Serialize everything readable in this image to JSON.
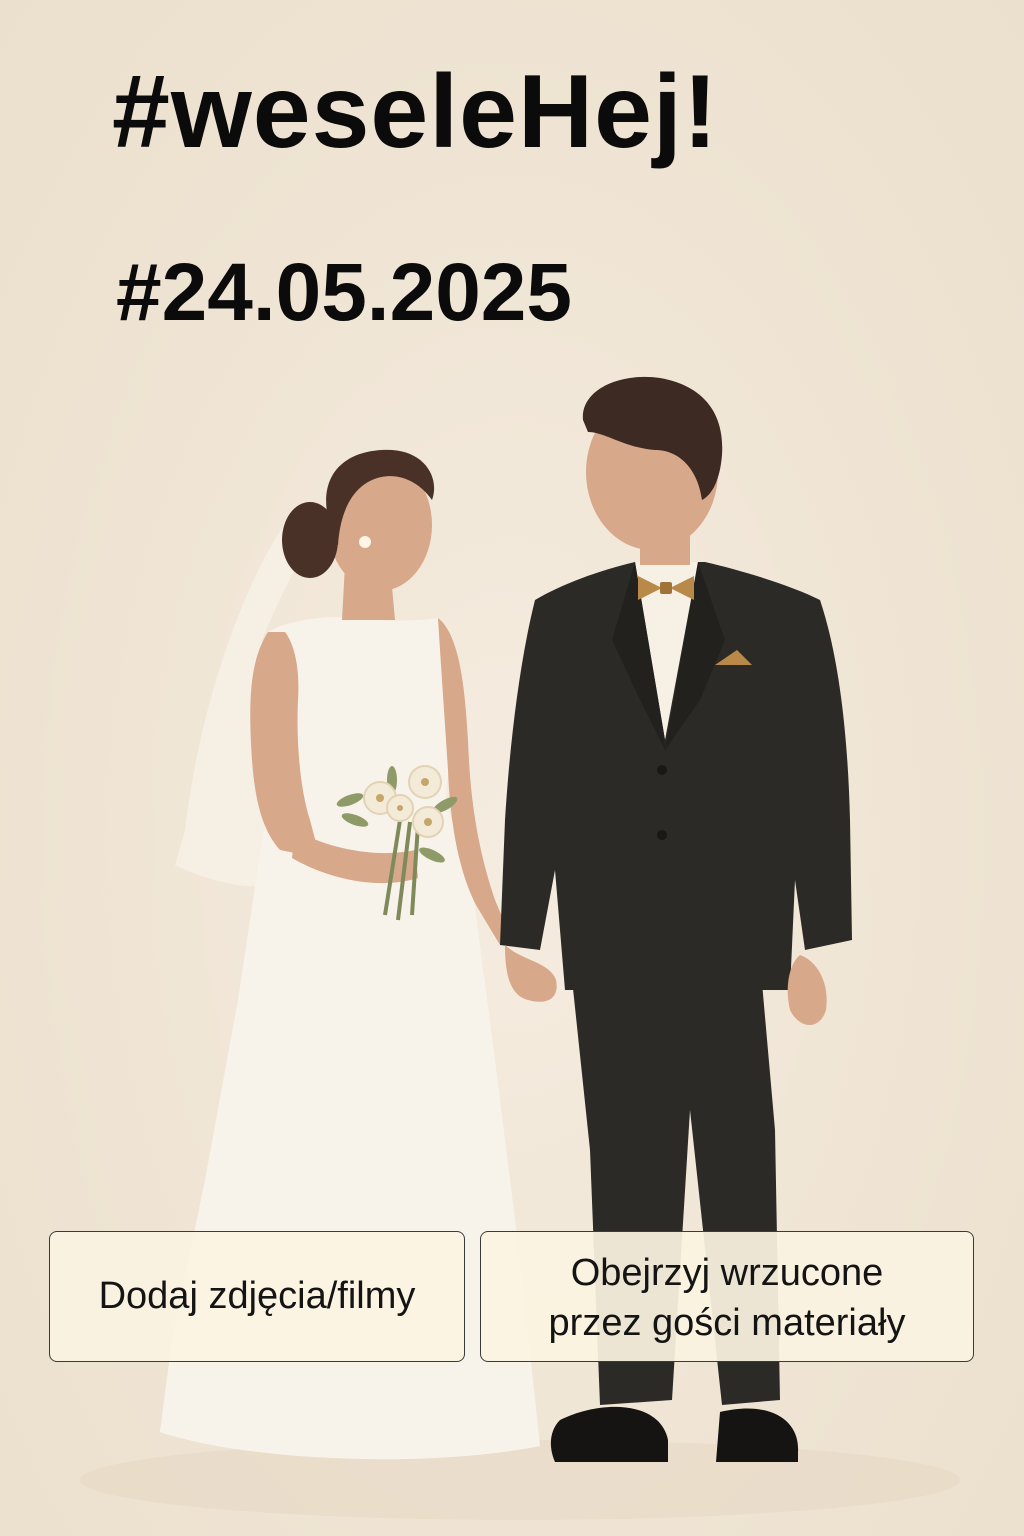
{
  "header": {
    "title": "#weseleHej!",
    "date": "#24.05.2025"
  },
  "actions": {
    "add_label": "Dodaj zdjęcia/filmy",
    "view_label_line1": "Obejrzyj wrzucone",
    "view_label_line2": "przez gości materiały"
  },
  "colors": {
    "background": "#f1e6d6",
    "text": "#0b0b0b",
    "suit": "#2c2a26",
    "dress": "#f7f2e8",
    "accent": "#b9894a",
    "button_fill": "#fbf3e1"
  }
}
